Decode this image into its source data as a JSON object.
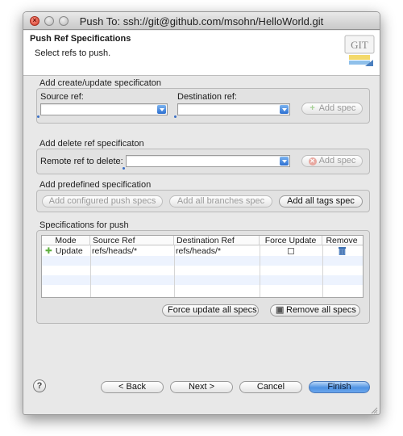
{
  "window": {
    "title": "Push To: ssh://git@github.com/msohn/HelloWorld.git",
    "close_glyph": "×"
  },
  "banner": {
    "title": "Push Ref Specifications",
    "description": "Select refs to push.",
    "logo_text": "GIT"
  },
  "create_group": {
    "label": "Add create/update specificaton",
    "source_label": "Source ref:",
    "source_value": "",
    "destination_label": "Destination ref:",
    "destination_value": "",
    "add_button": "Add spec",
    "add_icon": "plus-icon"
  },
  "delete_group": {
    "label": "Add delete ref specificaton",
    "remote_label": "Remote ref to delete:",
    "remote_value": "",
    "add_button": "Add spec",
    "add_icon": "delete-icon"
  },
  "predefined_group": {
    "label": "Add predefined specification",
    "buttons": [
      "Add configured push specs",
      "Add all branches spec",
      "Add all tags spec"
    ]
  },
  "specs_group": {
    "label": "Specifications for push",
    "columns": [
      "Mode",
      "Source Ref",
      "Destination Ref",
      "Force Update",
      "Remove"
    ],
    "rows": [
      {
        "mode": "Update",
        "source": "refs/heads/*",
        "destination": "refs/heads/*",
        "force": false,
        "mode_icon": "plus-icon",
        "remove_icon": "trash-icon"
      }
    ],
    "force_all_button": "Force update all specs",
    "remove_all_button": "Remove all specs"
  },
  "footer": {
    "help": "?",
    "back": "< Back",
    "next": "Next >",
    "cancel": "Cancel",
    "finish": "Finish"
  },
  "colors": {
    "accent": "#4f93e3",
    "add_icon": "#60b040",
    "delete_icon": "#d74b3c"
  }
}
